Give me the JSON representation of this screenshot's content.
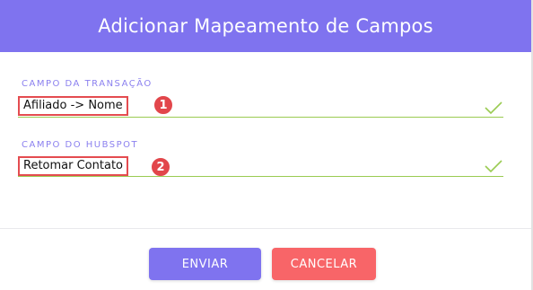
{
  "modal": {
    "title": "Adicionar Mapeamento de Campos"
  },
  "fields": [
    {
      "label": "CAMPO DA TRANSAÇÃO",
      "value": "Afiliado -> Nome",
      "badge": "1"
    },
    {
      "label": "CAMPO DO HUBSPOT",
      "value": "Retomar Contato",
      "badge": "2"
    }
  ],
  "buttons": {
    "submit_label": "ENVIAR",
    "cancel_label": "CANCELAR"
  },
  "colors": {
    "accent": "#7f73ef",
    "cancel": "#f86568",
    "valid": "#9acb52",
    "highlight": "#e2464b"
  },
  "icons": {
    "valid_indicator": "check-icon"
  }
}
